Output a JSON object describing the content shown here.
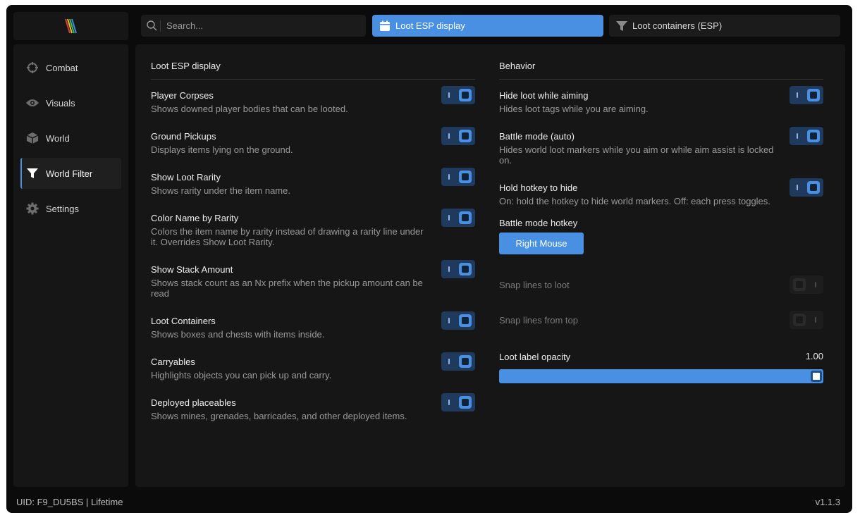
{
  "nav": {
    "items": [
      {
        "label": "Combat",
        "icon": "crosshair-icon"
      },
      {
        "label": "Visuals",
        "icon": "eye-icon"
      },
      {
        "label": "World",
        "icon": "cube-icon"
      },
      {
        "label": "World Filter",
        "icon": "filter-icon",
        "active": true
      },
      {
        "label": "Settings",
        "icon": "gear-icon"
      }
    ]
  },
  "search": {
    "placeholder": "Search..."
  },
  "tabs": [
    {
      "label": "Loot ESP display",
      "icon": "calendar-icon",
      "active": true
    },
    {
      "label": "Loot containers (ESP)",
      "icon": "filter-icon",
      "active": false
    }
  ],
  "left": {
    "title": "Loot ESP display",
    "settings": [
      {
        "label": "Player Corpses",
        "desc": "Shows downed player bodies that can be looted.",
        "on": true
      },
      {
        "label": "Ground Pickups",
        "desc": "Displays items lying on the ground.",
        "on": true
      },
      {
        "label": "Show Loot Rarity",
        "desc": "Shows rarity under the item name.",
        "on": true
      },
      {
        "label": "Color Name by Rarity",
        "desc": "Colors the item name by rarity instead of drawing a rarity line under it. Overrides Show Loot Rarity.",
        "on": true
      },
      {
        "label": "Show Stack Amount",
        "desc": "Shows stack count as an Nx prefix when the pickup amount can be read",
        "on": true
      },
      {
        "label": "Loot Containers",
        "desc": "Shows boxes and chests with items inside.",
        "on": true
      },
      {
        "label": "Carryables",
        "desc": "Highlights objects you can pick up and carry.",
        "on": true
      },
      {
        "label": "Deployed placeables",
        "desc": "Shows mines, grenades, barricades, and other deployed items.",
        "on": true
      }
    ]
  },
  "right": {
    "title": "Behavior",
    "settings": [
      {
        "label": "Hide loot while aiming",
        "desc": "Hides loot tags while you are aiming.",
        "on": true
      },
      {
        "label": "Battle mode (auto)",
        "desc": "Hides world loot markers while you aim or while aim assist is locked on.",
        "on": true
      },
      {
        "label": "Hold hotkey to hide",
        "desc": "On: hold the hotkey to hide world markers. Off: each press toggles.",
        "on": true
      }
    ],
    "hotkey_label": "Battle mode hotkey",
    "hotkey_value": "Right Mouse",
    "disabled_settings": [
      {
        "label": "Snap lines to loot",
        "on": false
      },
      {
        "label": "Snap lines from top",
        "on": false
      }
    ],
    "opacity_label": "Loot label opacity",
    "opacity_value": "1.00",
    "opacity_fraction": 1.0
  },
  "status": {
    "uid": "UID: F9_DU5BS | Lifetime",
    "version": "v1.1.3"
  },
  "colors": {
    "accent": "#4a90e2",
    "background": "#0b0b0b",
    "panel": "#161616"
  }
}
